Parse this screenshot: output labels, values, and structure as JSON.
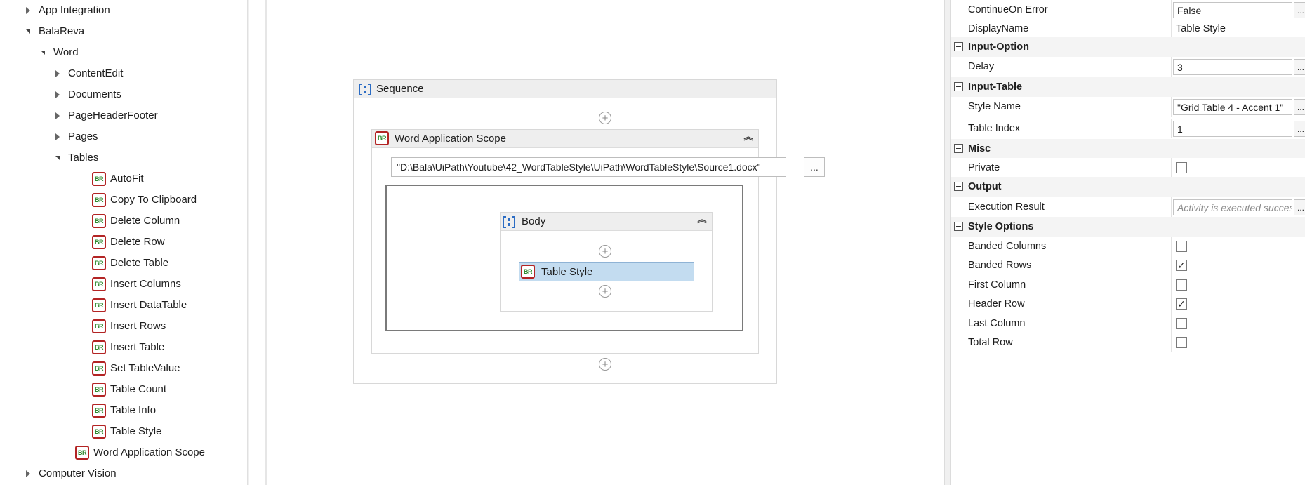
{
  "left_tree": {
    "items": [
      {
        "label": "App Integration",
        "level": 0,
        "state": "collapsed",
        "icon": null
      },
      {
        "label": "BalaReva",
        "level": 0,
        "state": "expanded",
        "icon": null
      },
      {
        "label": "Word",
        "level": 1,
        "state": "expanded",
        "icon": null
      },
      {
        "label": "ContentEdit",
        "level": 2,
        "state": "collapsed",
        "icon": null
      },
      {
        "label": "Documents",
        "level": 2,
        "state": "collapsed",
        "icon": null
      },
      {
        "label": "PageHeaderFooter",
        "level": 2,
        "state": "collapsed",
        "icon": null
      },
      {
        "label": "Pages",
        "level": 2,
        "state": "collapsed",
        "icon": null
      },
      {
        "label": "Tables",
        "level": 2,
        "state": "expanded",
        "icon": null
      },
      {
        "label": "AutoFit",
        "level": 3,
        "state": "leaf",
        "icon": "br-activity-icon"
      },
      {
        "label": "Copy To Clipboard",
        "level": 3,
        "state": "leaf",
        "icon": "br-activity-icon"
      },
      {
        "label": "Delete Column",
        "level": 3,
        "state": "leaf",
        "icon": "br-activity-icon"
      },
      {
        "label": "Delete Row",
        "level": 3,
        "state": "leaf",
        "icon": "br-activity-icon"
      },
      {
        "label": "Delete Table",
        "level": 3,
        "state": "leaf",
        "icon": "br-activity-icon"
      },
      {
        "label": "Insert Columns",
        "level": 3,
        "state": "leaf",
        "icon": "br-activity-icon"
      },
      {
        "label": "Insert DataTable",
        "level": 3,
        "state": "leaf",
        "icon": "br-activity-icon"
      },
      {
        "label": "Insert Rows",
        "level": 3,
        "state": "leaf",
        "icon": "br-activity-icon"
      },
      {
        "label": "Insert Table",
        "level": 3,
        "state": "leaf",
        "icon": "br-activity-icon"
      },
      {
        "label": "Set TableValue",
        "level": 3,
        "state": "leaf",
        "icon": "br-activity-icon"
      },
      {
        "label": "Table Count",
        "level": 3,
        "state": "leaf",
        "icon": "br-activity-icon"
      },
      {
        "label": "Table Info",
        "level": 3,
        "state": "leaf",
        "icon": "br-activity-icon"
      },
      {
        "label": "Table Style",
        "level": 3,
        "state": "leaf",
        "icon": "br-activity-icon"
      },
      {
        "label": "Word Application Scope",
        "level": 2,
        "state": "leaf",
        "icon": "br-activity-icon"
      },
      {
        "label": "Computer Vision",
        "level": 0,
        "state": "collapsed",
        "icon": null
      }
    ]
  },
  "designer": {
    "sequence_title": "Sequence",
    "scope_title": "Word Application Scope",
    "file_path": "\"D:\\Bala\\UiPath\\Youtube\\42_WordTableStyle\\UiPath\\WordTableStyle\\Source1.docx\"",
    "browse_label": "...",
    "body_title": "Body",
    "selected_activity": "Table Style",
    "activity_icon_text": "BR",
    "add_symbol": "+",
    "collapse_symbol": "︽"
  },
  "properties": {
    "rows": [
      {
        "kind": "prop",
        "name": "ContinueOn Error",
        "value": "False",
        "control": "input",
        "ellipsis": true
      },
      {
        "kind": "prop",
        "name": "DisplayName",
        "value": "Table Style",
        "control": "text",
        "ellipsis": false
      },
      {
        "kind": "category",
        "name": "Input-Option"
      },
      {
        "kind": "prop",
        "name": "Delay",
        "value": "3",
        "control": "input",
        "ellipsis": true
      },
      {
        "kind": "category",
        "name": "Input-Table"
      },
      {
        "kind": "prop",
        "name": "Style Name",
        "value": "\"Grid Table 4 - Accent 1\"",
        "control": "input",
        "ellipsis": true
      },
      {
        "kind": "prop",
        "name": "Table Index",
        "value": "1",
        "control": "input",
        "ellipsis": true
      },
      {
        "kind": "category",
        "name": "Misc"
      },
      {
        "kind": "prop",
        "name": "Private",
        "value": false,
        "control": "checkbox"
      },
      {
        "kind": "category",
        "name": "Output"
      },
      {
        "kind": "prop",
        "name": "Execution Result",
        "value": "Activity is executed successfully",
        "control": "placeholder",
        "ellipsis": true
      },
      {
        "kind": "category",
        "name": "Style Options"
      },
      {
        "kind": "prop",
        "name": "Banded Columns",
        "value": false,
        "control": "checkbox"
      },
      {
        "kind": "prop",
        "name": "Banded Rows",
        "value": true,
        "control": "checkbox"
      },
      {
        "kind": "prop",
        "name": "First Column",
        "value": false,
        "control": "checkbox"
      },
      {
        "kind": "prop",
        "name": "Header Row",
        "value": true,
        "control": "checkbox"
      },
      {
        "kind": "prop",
        "name": "Last Column",
        "value": false,
        "control": "checkbox"
      },
      {
        "kind": "prop",
        "name": "Total Row",
        "value": false,
        "control": "checkbox"
      }
    ],
    "ellipsis_label": "...",
    "check_mark": "✓"
  },
  "colors": {
    "accent_blue": "#2b6cc4",
    "br_icon_border": "#b32424",
    "br_icon_text": "#2f8a2f",
    "selection": "#c3dcf0"
  }
}
